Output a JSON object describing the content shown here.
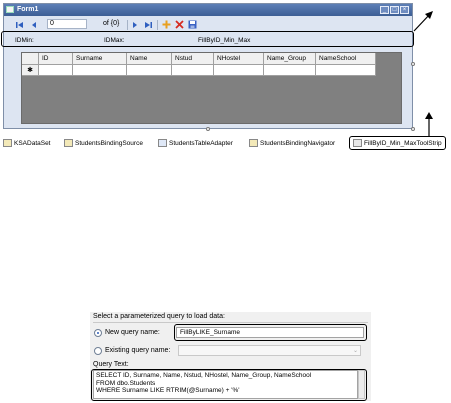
{
  "form": {
    "title": "Form1",
    "window_buttons": [
      "_",
      "□",
      "×"
    ]
  },
  "navigator": {
    "position_value": "0",
    "count_label": "of {0}",
    "icons": [
      "move-first-icon",
      "move-previous-icon",
      "move-next-icon",
      "move-last-icon",
      "add-new-icon",
      "delete-icon",
      "save-icon"
    ]
  },
  "fill_strip": {
    "idmin_label": "IDMin:",
    "idmax_label": "IDMax:",
    "button_label": "FillByID_Min_Max"
  },
  "grid": {
    "columns": [
      "ID",
      "Surname",
      "Name",
      "Nstud",
      "NHostel",
      "Name_Group",
      "NameSchool"
    ],
    "new_row_marker": "✱"
  },
  "tray": {
    "items": [
      {
        "label": "KSADataSet",
        "icon": "dataset-icon"
      },
      {
        "label": "StudentsBindingSource",
        "icon": "binding-source-icon"
      },
      {
        "label": "StudentsTableAdapter",
        "icon": "table-adapter-icon"
      },
      {
        "label": "StudentsBindingNavigator",
        "icon": "binding-navigator-icon"
      },
      {
        "label": "FillByID_Min_MaxToolStrip",
        "icon": "toolstrip-icon"
      }
    ]
  },
  "dialog": {
    "prompt": "Select a parameterized query to load data:",
    "new_query_label": "New query name:",
    "new_query_value": "FillByLIKE_Surname",
    "existing_query_label": "Existing query name:",
    "query_text_label": "Query Text:",
    "query_lines": [
      "SELECT ID, Surname, Name, Nstud, NHostel, Name_Group, NameSchool",
      "FROM dbo.Students",
      "WHERE Surname LIKE RTRIM(@Surname) + '%'"
    ]
  }
}
